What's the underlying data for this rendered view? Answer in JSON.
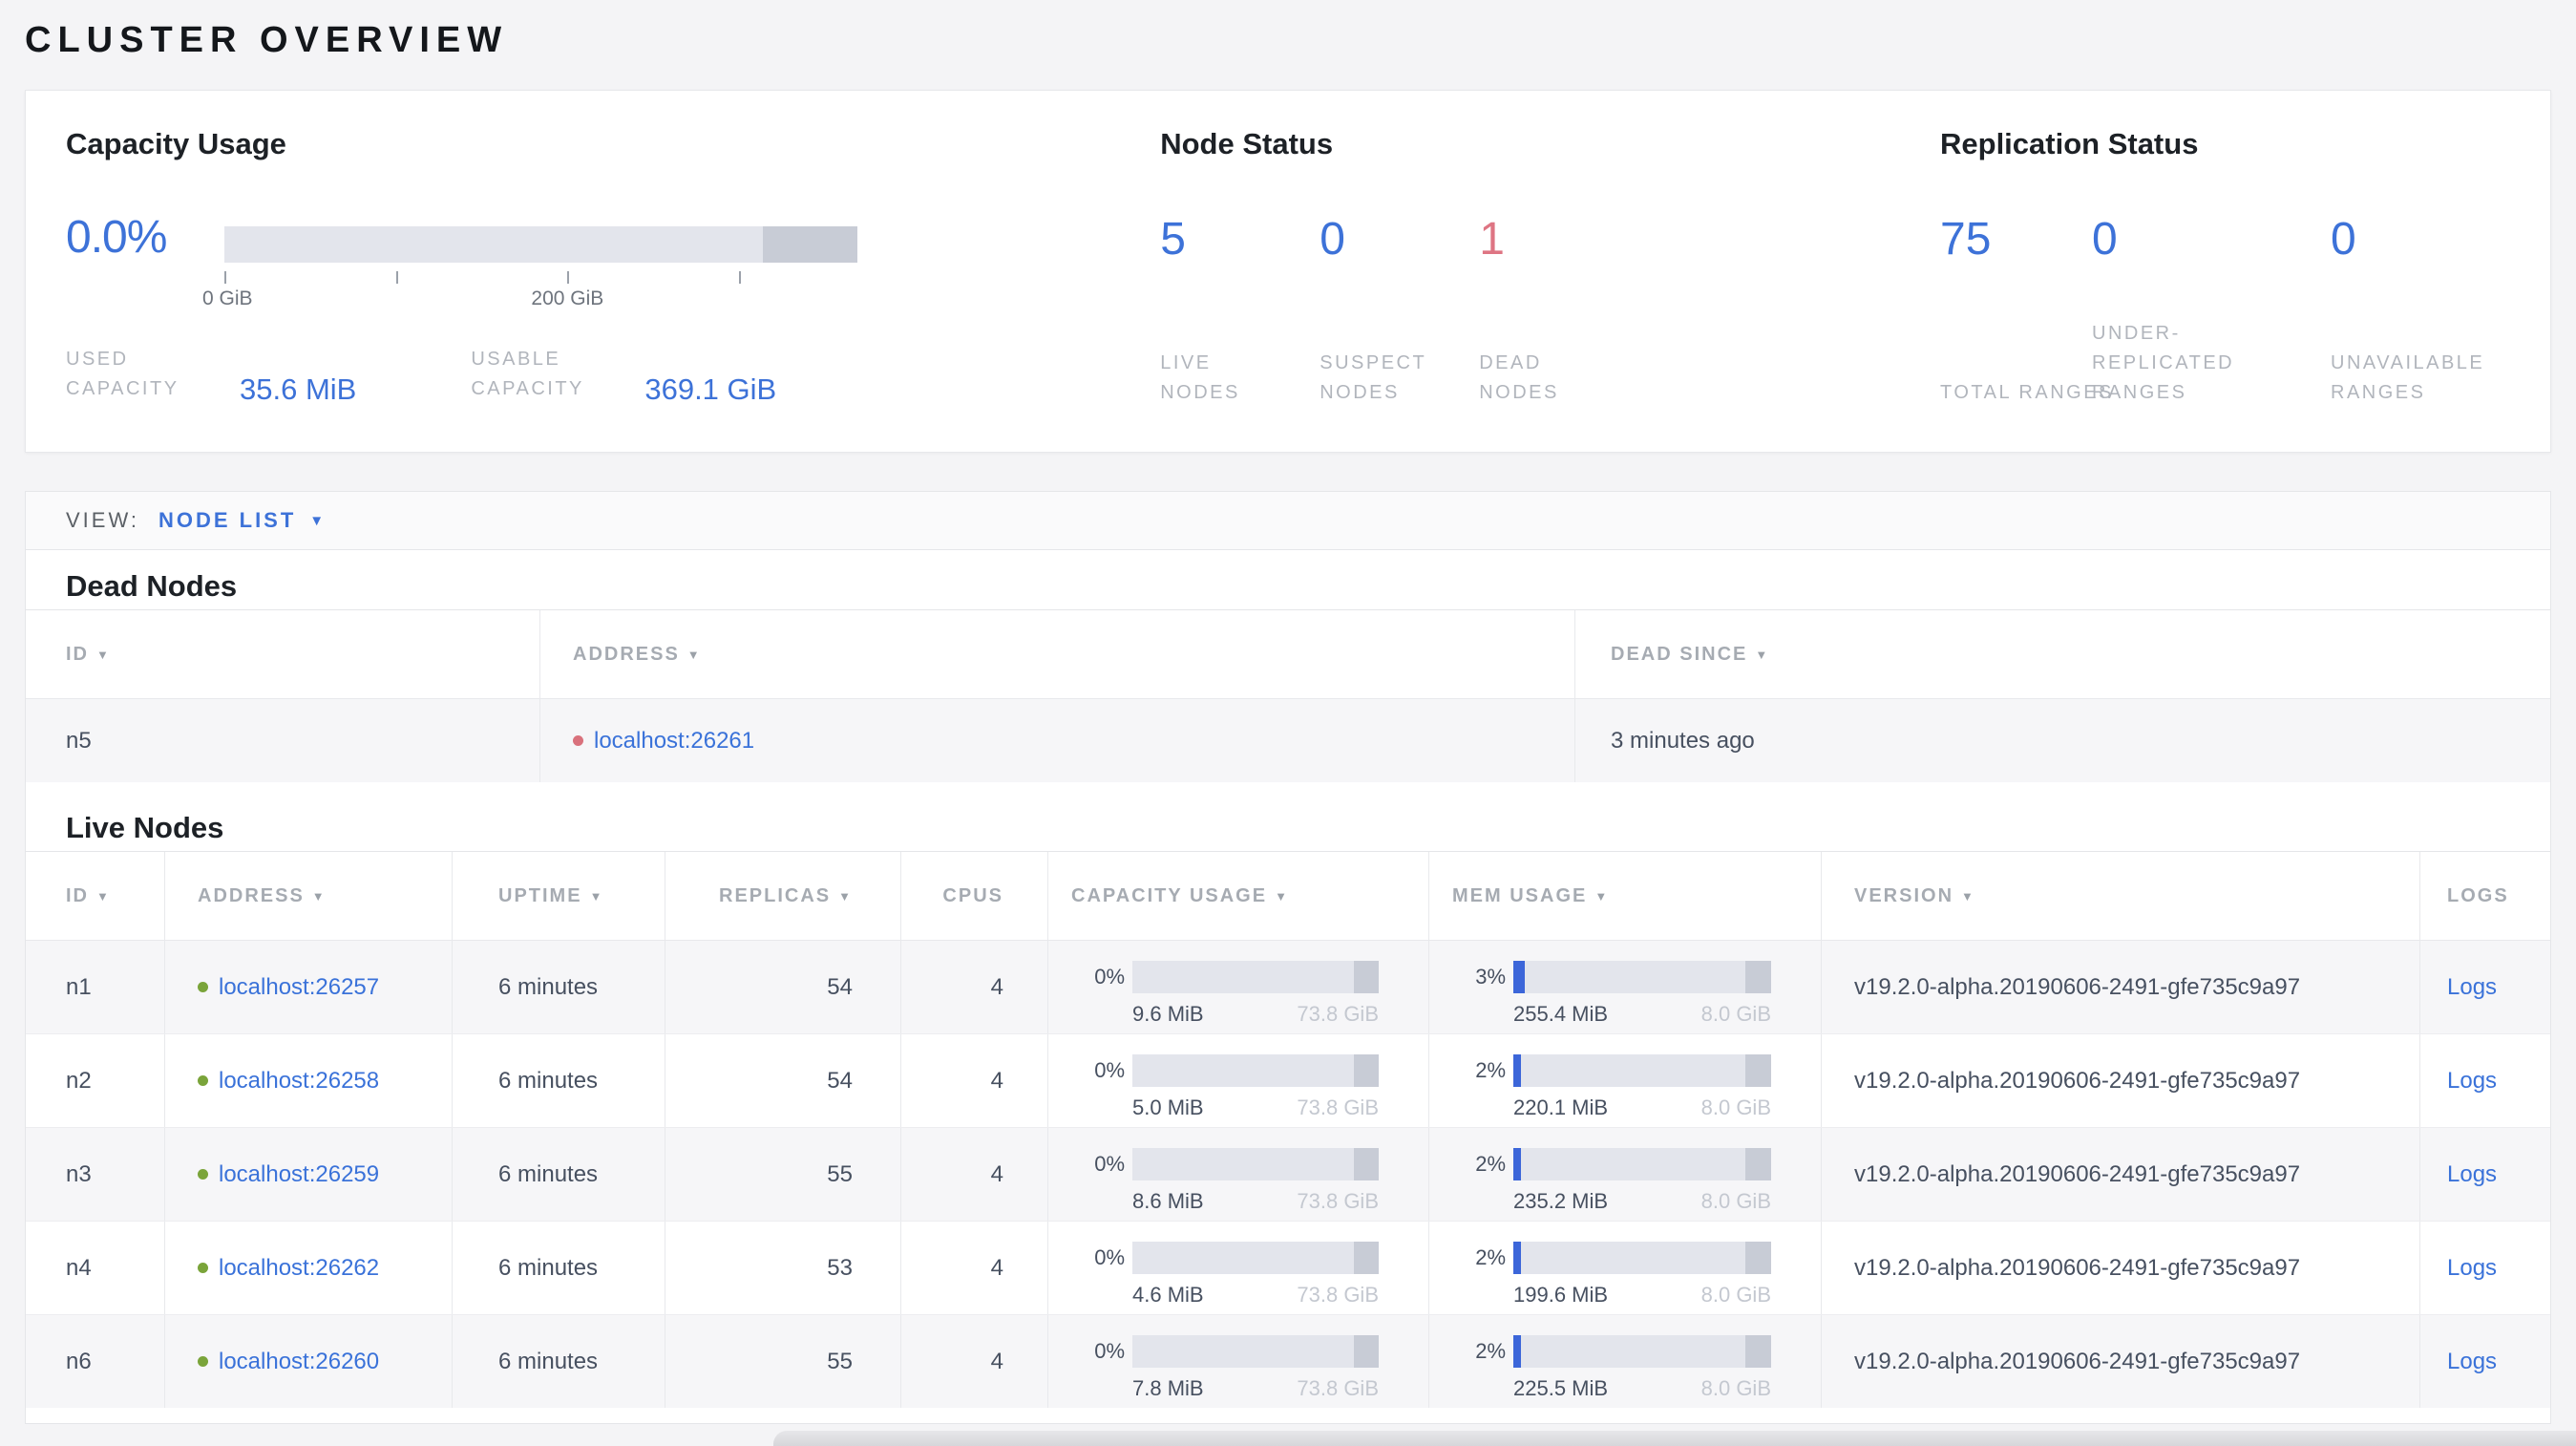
{
  "page_title": "CLUSTER OVERVIEW",
  "colors": {
    "accent_blue": "#3d72d8",
    "dead_red": "#de7583",
    "live_dot_green": "#7aa43a",
    "dead_dot_red": "#d9717c"
  },
  "summary": {
    "capacity": {
      "title": "Capacity Usage",
      "percent": "0.0%",
      "bar": {
        "used_pct": 0,
        "reserved_cap_pct": 15,
        "ticks_pct": [
          0,
          27.1,
          54.2,
          81.3
        ],
        "axis_labels": [
          {
            "text": "0 GiB",
            "pos_pct": 0.5
          },
          {
            "text": "200 GiB",
            "pos_pct": 54.2
          }
        ]
      },
      "stats": [
        {
          "label": "USED CAPACITY",
          "value": "35.6 MiB"
        },
        {
          "label": "USABLE CAPACITY",
          "value": "369.1 GiB"
        }
      ]
    },
    "node_status": {
      "title": "Node Status",
      "stats": [
        {
          "value": "5",
          "label": "LIVE NODES",
          "color": "#3d72d8"
        },
        {
          "value": "0",
          "label": "SUSPECT NODES",
          "color": "#3d72d8"
        },
        {
          "value": "1",
          "label": "DEAD NODES",
          "color": "#de7583"
        }
      ]
    },
    "replication": {
      "title": "Replication Status",
      "stats": [
        {
          "value": "75",
          "label": "TOTAL RANGES",
          "color": "#3d72d8"
        },
        {
          "value": "0",
          "label": "UNDER-REPLICATED RANGES",
          "color": "#3d72d8"
        },
        {
          "value": "0",
          "label": "UNAVAILABLE RANGES",
          "color": "#3d72d8"
        }
      ]
    }
  },
  "view_bar": {
    "label": "VIEW:",
    "selected": "NODE LIST",
    "caret": "▼"
  },
  "dead_nodes": {
    "title": "Dead Nodes",
    "columns": [
      {
        "label": "ID",
        "sortable": true
      },
      {
        "label": "ADDRESS",
        "sortable": true
      },
      {
        "label": "DEAD SINCE",
        "sortable": true
      }
    ],
    "rows": [
      {
        "id": "n5",
        "address": "localhost:26261",
        "dead_since": "3 minutes ago"
      }
    ]
  },
  "live_nodes": {
    "title": "Live Nodes",
    "columns": [
      {
        "label": "ID",
        "sortable": true
      },
      {
        "label": "ADDRESS",
        "sortable": true
      },
      {
        "label": "UPTIME",
        "sortable": true
      },
      {
        "label": "REPLICAS",
        "sortable": true
      },
      {
        "label": "CPUS",
        "sortable": false
      },
      {
        "label": "CAPACITY USAGE",
        "sortable": true
      },
      {
        "label": "MEM USAGE",
        "sortable": true
      },
      {
        "label": "VERSION",
        "sortable": true
      },
      {
        "label": "LOGS",
        "sortable": false
      }
    ],
    "logs_label": "Logs",
    "rows": [
      {
        "id": "n1",
        "address": "localhost:26257",
        "uptime": "6 minutes",
        "replicas": "54",
        "cpus": "4",
        "capacity": {
          "pct": "0%",
          "used": "9.6 MiB",
          "total": "73.8 GiB",
          "fill_pct": 0
        },
        "mem": {
          "pct": "3%",
          "used": "255.4 MiB",
          "total": "8.0 GiB",
          "fill_pct": 4.5
        },
        "version": "v19.2.0-alpha.20190606-2491-gfe735c9a97"
      },
      {
        "id": "n2",
        "address": "localhost:26258",
        "uptime": "6 minutes",
        "replicas": "54",
        "cpus": "4",
        "capacity": {
          "pct": "0%",
          "used": "5.0 MiB",
          "total": "73.8 GiB",
          "fill_pct": 0
        },
        "mem": {
          "pct": "2%",
          "used": "220.1 MiB",
          "total": "8.0 GiB",
          "fill_pct": 3
        },
        "version": "v19.2.0-alpha.20190606-2491-gfe735c9a97"
      },
      {
        "id": "n3",
        "address": "localhost:26259",
        "uptime": "6 minutes",
        "replicas": "55",
        "cpus": "4",
        "capacity": {
          "pct": "0%",
          "used": "8.6 MiB",
          "total": "73.8 GiB",
          "fill_pct": 0
        },
        "mem": {
          "pct": "2%",
          "used": "235.2 MiB",
          "total": "8.0 GiB",
          "fill_pct": 3
        },
        "version": "v19.2.0-alpha.20190606-2491-gfe735c9a97"
      },
      {
        "id": "n4",
        "address": "localhost:26262",
        "uptime": "6 minutes",
        "replicas": "53",
        "cpus": "4",
        "capacity": {
          "pct": "0%",
          "used": "4.6 MiB",
          "total": "73.8 GiB",
          "fill_pct": 0
        },
        "mem": {
          "pct": "2%",
          "used": "199.6 MiB",
          "total": "8.0 GiB",
          "fill_pct": 3
        },
        "version": "v19.2.0-alpha.20190606-2491-gfe735c9a97"
      },
      {
        "id": "n6",
        "address": "localhost:26260",
        "uptime": "6 minutes",
        "replicas": "55",
        "cpus": "4",
        "capacity": {
          "pct": "0%",
          "used": "7.8 MiB",
          "total": "73.8 GiB",
          "fill_pct": 0
        },
        "mem": {
          "pct": "2%",
          "used": "225.5 MiB",
          "total": "8.0 GiB",
          "fill_pct": 3
        },
        "version": "v19.2.0-alpha.20190606-2491-gfe735c9a97"
      }
    ]
  }
}
